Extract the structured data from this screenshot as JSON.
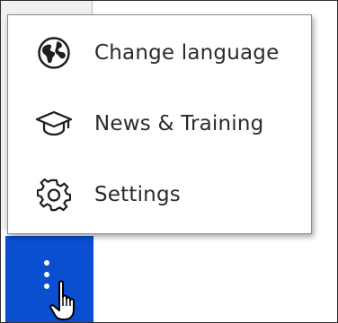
{
  "menu": {
    "items": [
      {
        "label": "Change language",
        "icon": "globe-icon"
      },
      {
        "label": "News & Training",
        "icon": "graduation-cap-icon"
      },
      {
        "label": "Settings",
        "icon": "gear-icon"
      }
    ]
  },
  "sidebar": {
    "more_button": {
      "icon": "kebab-vertical-icon",
      "color": "#0a4fd0"
    }
  },
  "cursor": {
    "icon": "hand-pointer-icon"
  }
}
